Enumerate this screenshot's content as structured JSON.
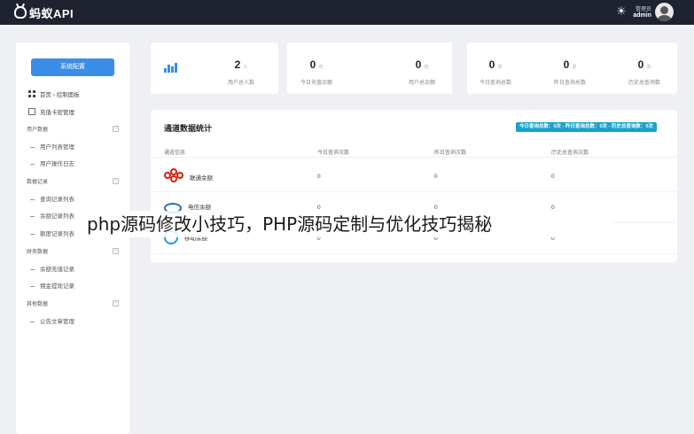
{
  "header": {
    "logo_text": "蚂蚁API",
    "user_role": "管理员",
    "user_name": "admin"
  },
  "sidebar": {
    "primary_button": "系统配置",
    "items": [
      {
        "label": "首页 › 控制面板",
        "icon": "grid-icon"
      },
      {
        "label": "充值卡密管理",
        "icon": "card-icon"
      }
    ],
    "groups": [
      {
        "title": "用户数据",
        "toggle": "−",
        "items": [
          "用户列表管理",
          "用户操作日志"
        ]
      },
      {
        "title": "数据记录",
        "toggle": "−",
        "items": [
          "查询记录列表",
          "余额记录列表",
          "额度记录列表"
        ]
      },
      {
        "title": "财务数据",
        "toggle": "−",
        "items": [
          "余额充值记录",
          "佣金提现记录"
        ]
      },
      {
        "title": "其他数据",
        "toggle": "−",
        "items": [
          "公告文章管理"
        ]
      }
    ]
  },
  "stats": [
    {
      "value": "2",
      "unit": "人",
      "label": "用户总人数"
    },
    {
      "value": "0",
      "unit": "元",
      "label": "今日充值余额"
    },
    {
      "value": "0",
      "unit": "元",
      "label": "用户总余额"
    },
    {
      "value": "0",
      "unit": "次",
      "label": "今日查询总数"
    },
    {
      "value": "0",
      "unit": "次",
      "label": "昨日查询总数"
    },
    {
      "value": "0",
      "unit": "次",
      "label": "历史总查询数"
    }
  ],
  "panel": {
    "title": "通道数据统计",
    "summary": "今日查询总数：0次 - 昨日查询总数：0次 - 历史总查询数：0次",
    "columns": [
      "通道信息",
      "今日查询次数",
      "昨日查询次数",
      "历史总查询次数"
    ],
    "rows": [
      {
        "name": "联通余额",
        "logo": "unicom-logo",
        "today": "0",
        "yesterday": "0",
        "total": "0"
      },
      {
        "name": "电信余额",
        "logo": "telecom-logo",
        "today": "0",
        "yesterday": "0",
        "total": "0"
      },
      {
        "name": "移动余额",
        "logo": "mobile-logo",
        "today": "0",
        "yesterday": "0",
        "total": "0"
      }
    ]
  },
  "watermark": "php源码修改小技巧，PHP源码定制与优化技巧揭秘",
  "colors": {
    "topbar": "#1f2330",
    "accent": "#3a8ee6",
    "badge": "#17a2c8",
    "unicom": "#d81e06"
  }
}
